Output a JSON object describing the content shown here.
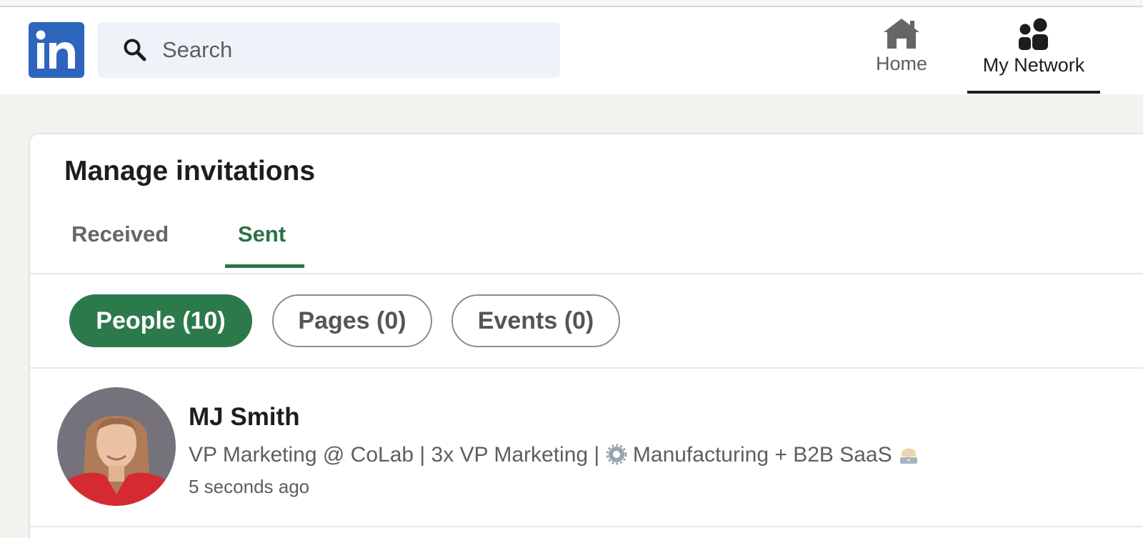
{
  "header": {
    "logo_text": "in",
    "search": {
      "placeholder": "Search",
      "icon": "search-icon"
    },
    "nav": [
      {
        "label": "Home",
        "icon": "home-icon",
        "active": false
      },
      {
        "label": "My Network",
        "icon": "people-icon",
        "active": true
      }
    ]
  },
  "invitations": {
    "title": "Manage invitations",
    "tabs": [
      {
        "label": "Received",
        "active": false
      },
      {
        "label": "Sent",
        "active": true
      }
    ],
    "filters": [
      {
        "label": "People (10)",
        "selected": true
      },
      {
        "label": "Pages (0)",
        "selected": false
      },
      {
        "label": "Events (0)",
        "selected": false
      }
    ],
    "items": [
      {
        "name": "MJ Smith",
        "headline_part1": "VP Marketing @ CoLab | 3x VP Marketing |",
        "headline_part2": "Manufacturing + B2B SaaS",
        "time": "5 seconds ago"
      }
    ]
  },
  "colors": {
    "brand_blue": "#2d64bc",
    "accent_green": "#2c7a4b",
    "search_bg": "#edf3f8",
    "page_bg": "#f3f2ef"
  }
}
